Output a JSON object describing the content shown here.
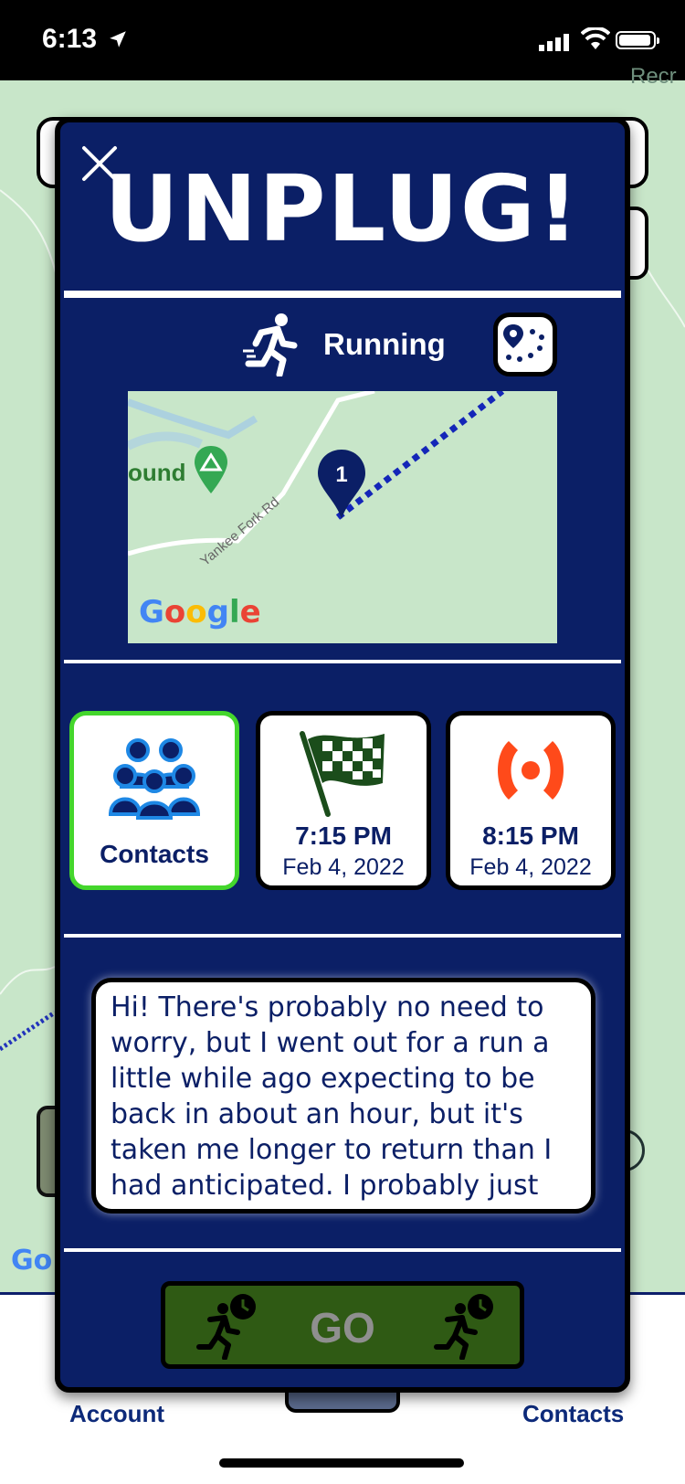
{
  "status_bar": {
    "time": "6:13"
  },
  "background": {
    "map_label_partial": "Recr",
    "google_partial": "Go"
  },
  "bottom_nav": {
    "account_label": "Account",
    "contacts_label": "Contacts"
  },
  "modal": {
    "title": "UNPLUG!",
    "activity": {
      "label": "Running",
      "icon": "running-person-icon"
    },
    "mini_map": {
      "place_label": "ound",
      "road_label": "Yankee Fork Rd",
      "marker_number": "1",
      "google_logo": [
        "G",
        "o",
        "o",
        "g",
        "l",
        "e"
      ],
      "google_colors": [
        "#4285f4",
        "#ea4335",
        "#fbbc05",
        "#4285f4",
        "#34a853",
        "#ea4335"
      ]
    },
    "cards": {
      "contacts": {
        "label": "Contacts",
        "icon": "people-group-icon"
      },
      "start": {
        "time": "7:15 PM",
        "date": "Feb 4, 2022",
        "icon": "checkered-flag-icon"
      },
      "alert": {
        "time": "8:15 PM",
        "date": "Feb 4, 2022",
        "icon": "alert-signal-icon"
      }
    },
    "message": {
      "text": "Hi! There's probably no need to\nworry, but I went out for a run a\nlittle while ago expecting to be\nback in about an hour, but it's\ntaken me longer to return than I\nhad anticipated. I probably just c..."
    },
    "go_button": {
      "label": "GO"
    },
    "colors": {
      "modal_bg": "#0b1f66",
      "contacts_border": "#44d62c",
      "alert_orange": "#ff4a1a",
      "go_bg": "#2f5a14"
    }
  }
}
